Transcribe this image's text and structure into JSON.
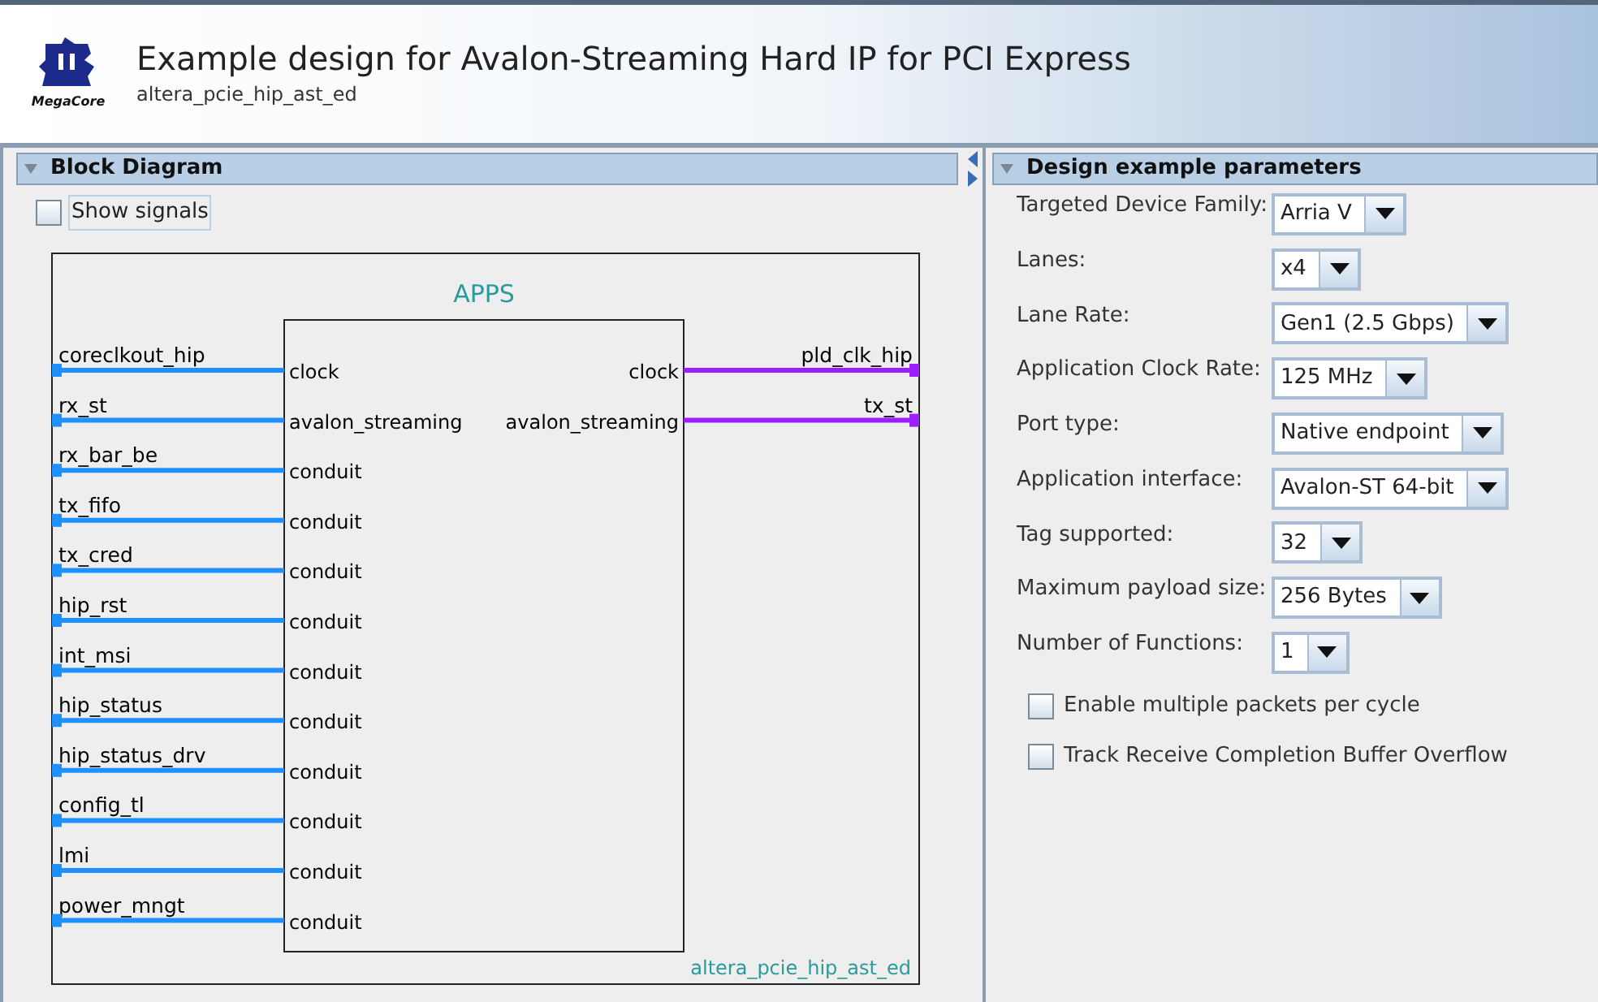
{
  "header": {
    "title": "Example design for Avalon-Streaming Hard IP for PCI Express",
    "subtitle": "altera_pcie_hip_ast_ed",
    "logo_text": "MegaCore"
  },
  "block_diagram": {
    "title": "Block Diagram",
    "expanded": true,
    "show_signals": {
      "label": "Show signals",
      "checked": false
    },
    "diagram": {
      "module_title": "APPS",
      "instance": "altera_pcie_hip_ast_ed",
      "left_ports": [
        {
          "name": "coreclkout_hip",
          "interface": "clock",
          "color": "#1e90ff"
        },
        {
          "name": "rx_st",
          "interface": "avalon_streaming",
          "color": "#1e90ff"
        },
        {
          "name": "rx_bar_be",
          "interface": "conduit",
          "color": "#1e90ff"
        },
        {
          "name": "tx_fifo",
          "interface": "conduit",
          "color": "#1e90ff"
        },
        {
          "name": "tx_cred",
          "interface": "conduit",
          "color": "#1e90ff"
        },
        {
          "name": "hip_rst",
          "interface": "conduit",
          "color": "#1e90ff"
        },
        {
          "name": "int_msi",
          "interface": "conduit",
          "color": "#1e90ff"
        },
        {
          "name": "hip_status",
          "interface": "conduit",
          "color": "#1e90ff"
        },
        {
          "name": "hip_status_drv",
          "interface": "conduit",
          "color": "#1e90ff"
        },
        {
          "name": "config_tl",
          "interface": "conduit",
          "color": "#1e90ff"
        },
        {
          "name": "lmi",
          "interface": "conduit",
          "color": "#1e90ff"
        },
        {
          "name": "power_mngt",
          "interface": "conduit",
          "color": "#1e90ff"
        }
      ],
      "right_ports": [
        {
          "name": "pld_clk_hip",
          "interface": "clock",
          "color": "#9b1eff"
        },
        {
          "name": "tx_st",
          "interface": "avalon_streaming",
          "color": "#9b1eff"
        }
      ]
    }
  },
  "parameters": {
    "title": "Design example parameters",
    "expanded": true,
    "fields": [
      {
        "label": "Targeted Device Family:",
        "value": "Arria V"
      },
      {
        "label": "Lanes:",
        "value": "x4"
      },
      {
        "label": "Lane Rate:",
        "value": "Gen1 (2.5 Gbps)"
      },
      {
        "label": "Application Clock Rate:",
        "value": "125 MHz"
      },
      {
        "label": "Port type:",
        "value": "Native endpoint"
      },
      {
        "label": "Application interface:",
        "value": "Avalon-ST 64-bit"
      },
      {
        "label": "Tag supported:",
        "value": "32"
      },
      {
        "label": "Maximum payload size:",
        "value": "256 Bytes"
      },
      {
        "label": "Number of Functions:",
        "value": "1"
      }
    ],
    "checkboxes": [
      {
        "label": "Enable multiple packets per cycle",
        "checked": false
      },
      {
        "label": "Track Receive Completion Buffer Overflow",
        "checked": false
      }
    ]
  }
}
